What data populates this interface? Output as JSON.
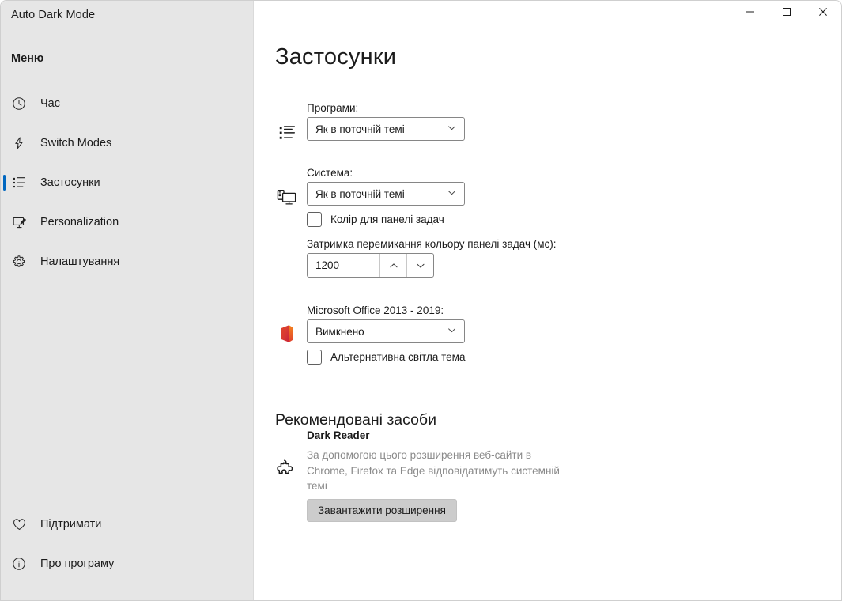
{
  "window": {
    "title": "Auto Dark Mode",
    "controls": [
      {
        "name": "minimize",
        "glyph": "minimize-icon"
      },
      {
        "name": "maximize",
        "glyph": "maximize-icon"
      },
      {
        "name": "close",
        "glyph": "close-icon"
      }
    ]
  },
  "sidebar": {
    "heading": "Меню",
    "items": [
      {
        "label": "Час",
        "icon": "clock-icon",
        "selected": false
      },
      {
        "label": "Switch Modes",
        "icon": "lightning-icon",
        "selected": false
      },
      {
        "label": "Застосунки",
        "icon": "apps-list-icon",
        "selected": true
      },
      {
        "label": "Personalization",
        "icon": "monitor-pen-icon",
        "selected": false
      },
      {
        "label": "Налаштування",
        "icon": "gear-icon",
        "selected": false
      }
    ],
    "bottom_items": [
      {
        "label": "Підтримати",
        "icon": "heart-icon"
      },
      {
        "label": "Про програму",
        "icon": "info-icon"
      }
    ],
    "accent_color": "#0067c0",
    "background_color": "#e6e6e6"
  },
  "main": {
    "page_title": "Застосунки",
    "apps": {
      "label": "Програми:",
      "icon": "apps-list-icon",
      "value": "Як в поточній темі"
    },
    "system": {
      "label": "Система:",
      "icon": "monitor-taskbar-icon",
      "value": "Як в поточній темі",
      "taskbar_checkbox_label": "Колір для панелі задач",
      "taskbar_checkbox_checked": false,
      "delay_label": "Затримка перемикання кольору панелі задач (мс):",
      "delay_value": "1200"
    },
    "office": {
      "label": "Microsoft Office 2013 - 2019:",
      "icon": "office-icon",
      "value": "Вимкнено",
      "alt_theme_checkbox_label": "Альтернативна світла тема",
      "alt_theme_checkbox_checked": false
    },
    "recommended": {
      "section_title": "Рекомендовані засоби",
      "item_name": "Dark Reader",
      "icon": "puzzle-piece-icon",
      "description": "За допомогою цього розширення веб-сайти в Chrome, Firefox та Edge відповідатимуть системній темі",
      "button_label": "Завантажити розширення"
    }
  }
}
